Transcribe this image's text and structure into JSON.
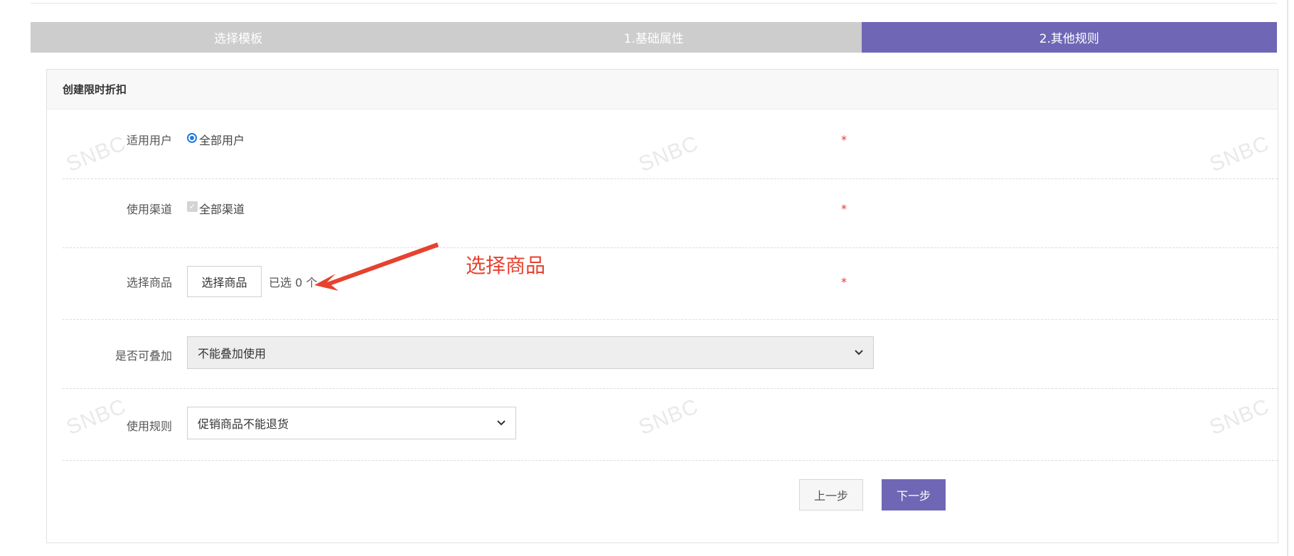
{
  "steps": [
    {
      "label": "选择模板",
      "active": false
    },
    {
      "label": "1.基础属性",
      "active": false
    },
    {
      "label": "2.其他规则",
      "active": true
    }
  ],
  "card": {
    "title": "创建限时折扣"
  },
  "form": {
    "user_scope": {
      "label": "适用用户",
      "option": "全部用户",
      "required_mark": "*"
    },
    "channel": {
      "label": "使用渠道",
      "option": "全部渠道",
      "required_mark": "*"
    },
    "product": {
      "label": "选择商品",
      "button": "选择商品",
      "selected_text": "已选 0 个",
      "required_mark": "*"
    },
    "stackable": {
      "label": "是否可叠加",
      "value": "不能叠加使用"
    },
    "usage_rule": {
      "label": "使用规则",
      "value": "促销商品不能退货"
    }
  },
  "actions": {
    "prev": "上一步",
    "next": "下一步"
  },
  "annotation": {
    "text": "选择商品"
  },
  "watermark": "SNBC",
  "colors": {
    "accent": "#6f67b5",
    "step_inactive": "#cdcdcd",
    "required": "#ee3333",
    "annotation": "#e6422f"
  }
}
